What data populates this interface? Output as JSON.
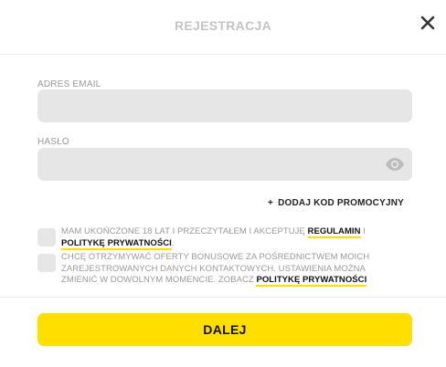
{
  "header": {
    "title": "REJESTRACJA",
    "close_icon": "close-icon"
  },
  "form": {
    "email": {
      "label": "ADRES EMAIL",
      "value": "",
      "placeholder": ""
    },
    "password": {
      "label": "HASŁO",
      "value": "",
      "placeholder": "",
      "toggle_icon": "eye-icon"
    },
    "promo": {
      "plus": "+",
      "label": "DODAJ KOD PROMOCYJNY"
    },
    "consents": [
      {
        "checked": false,
        "text_before": "MAM UKOŃCZONE 18 LAT I PRZECZYTAŁEM I AKCEPTUJĘ",
        "link1": "REGULAMIN",
        "text_mid": "I",
        "link2": "POLITYKĘ PRYWATNOŚCI",
        "text_after": "."
      },
      {
        "checked": false,
        "text_before": "CHCĘ OTRZYMYWAĆ OFERTY BONUSOWE ZA POŚREDNICTWEM MOICH ZAREJESTROWANYCH DANYCH KONTAKTOWYCH. USTAWIENIA MOŻNA ZMIENIĆ W DOWOLNYM MOMENCIE. ZOBACZ",
        "link1": "POLITYKĘ PRYWATNOŚCI"
      }
    ],
    "submit_label": "DALEJ"
  },
  "colors": {
    "accent": "#ffde00",
    "field_bg": "#e6e6e6",
    "muted_text": "#9a9a9a",
    "title_text": "#c4c4c4"
  }
}
